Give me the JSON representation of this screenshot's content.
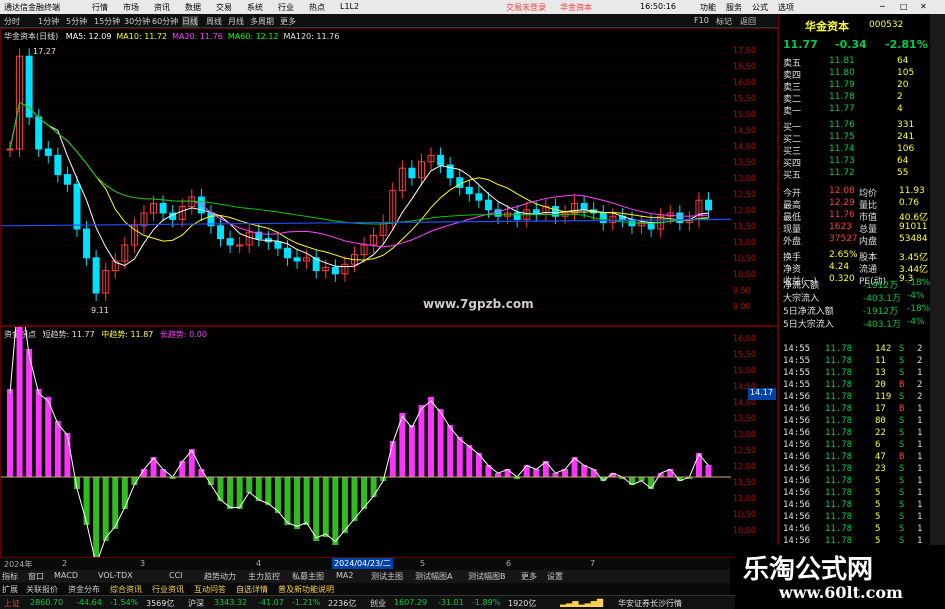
{
  "titlebar": {
    "app": "通达信金融终端",
    "menu": [
      "行情",
      "市场",
      "资讯",
      "数据",
      "交易",
      "系统",
      "行业",
      "热点",
      "L1L2"
    ],
    "login": "交易未登录",
    "stock": "华金资本",
    "time": "16:50:16",
    "buttons": [
      "功能",
      "服务",
      "公式",
      "选项"
    ]
  },
  "toolbar": {
    "periods": [
      "分时",
      "1分钟",
      "5分钟",
      "15分钟",
      "30分钟",
      "60分钟",
      "日线",
      "周线",
      "月线",
      "多周期",
      "更多"
    ],
    "right": [
      "F10",
      "标记",
      "返回"
    ]
  },
  "main": {
    "title": "华金资本(日线)",
    "ma": [
      {
        "label": "MA5: 12.09",
        "color": "#ffffff"
      },
      {
        "label": "MA10: 11.72",
        "color": "#ffff00"
      },
      {
        "label": "MA20: 11.76",
        "color": "#ff40ff"
      },
      {
        "label": "MA60: 12.12",
        "color": "#00ff00"
      },
      {
        "label": "MA120: 11.76",
        "color": "#e0e0e0"
      }
    ],
    "high_mark": "17.27",
    "low_mark": "9.11",
    "site": "www.7gpzb.com",
    "yticks": [
      "17.00",
      "16.50",
      "16.00",
      "15.50",
      "15.00",
      "14.50",
      "14.00",
      "13.50",
      "13.00",
      "12.50",
      "12.00",
      "11.50",
      "11.00",
      "10.50",
      "10.00",
      "9.50",
      "9.00"
    ]
  },
  "sub": {
    "title": "资金拐点",
    "label1": "短趋势: 11.77",
    "label2": "中趋势: 11.87",
    "label3": "长趋势: 0.00",
    "yticks": [
      "16.00",
      "15.50",
      "15.00",
      "14.50",
      "14.00",
      "13.50",
      "13.00",
      "12.50",
      "12.00",
      "11.50",
      "11.00",
      "10.50",
      "10.00"
    ],
    "cursor": "14.17",
    "date_left": "2024年",
    "date_mid": "2024/04/23/二",
    "months": [
      "2",
      "3",
      "4",
      "5",
      "6",
      "7"
    ]
  },
  "tabs": [
    "指标",
    "窗口",
    "MACD",
    "VOL-TDX",
    "CCI",
    "趋势动力",
    "主力监控",
    "私募主图",
    "MA2",
    "测试主图",
    "测试幅图A",
    "测试幅图B",
    "更多",
    "设置"
  ],
  "tabs2": [
    "扩展",
    "关联报价",
    "资金分布",
    "综合资讯",
    "行业资讯",
    "互动问答",
    "自选详情",
    "普及新功能说明"
  ],
  "status": {
    "sh_label": "上证",
    "sh_val": "2860.70",
    "sh_chg": "-44.64",
    "sh_pct": "-1.54%",
    "sh_amt": "3569亿",
    "sz_label": "沪深",
    "sz_val": "3343.32",
    "sz_chg": "-41.07",
    "sz_pct": "-1.21%",
    "sz_amt": "2236亿",
    "cy_label": "创业",
    "cy_val": "1607.29",
    "cy_chg": "-31.01",
    "cy_pct": "-1.89%",
    "cy_amt": "1920亿",
    "broker": "华安证券长沙行情"
  },
  "quote": {
    "name": "华金资本",
    "code": "000532",
    "price": "11.77",
    "chg": "-0.34",
    "pct": "-2.81%",
    "asks": [
      {
        "l": "卖五",
        "p": "11.81",
        "v": "64"
      },
      {
        "l": "卖四",
        "p": "11.80",
        "v": "105"
      },
      {
        "l": "卖三",
        "p": "11.79",
        "v": "20"
      },
      {
        "l": "卖二",
        "p": "11.78",
        "v": "2"
      },
      {
        "l": "卖一",
        "p": "11.77",
        "v": "4"
      }
    ],
    "bids": [
      {
        "l": "买一",
        "p": "11.76",
        "v": "331"
      },
      {
        "l": "买二",
        "p": "11.75",
        "v": "241"
      },
      {
        "l": "买三",
        "p": "11.74",
        "v": "106"
      },
      {
        "l": "买四",
        "p": "11.73",
        "v": "64"
      },
      {
        "l": "买五",
        "p": "11.72",
        "v": "55"
      }
    ],
    "stats": [
      [
        "今开",
        "12.08",
        "均价",
        "11.93"
      ],
      [
        "最高",
        "12.29",
        "量比",
        "0.76"
      ],
      [
        "最低",
        "11.76",
        "市值",
        "40.6亿"
      ],
      [
        "现量",
        "1623",
        "总量",
        "91011"
      ],
      [
        "外盘",
        "37527",
        "内盘",
        "53484"
      ]
    ],
    "stats2": [
      [
        "换手",
        "2.65%",
        "股本",
        "3.45亿"
      ],
      [
        "净资",
        "4.24",
        "流通",
        "3.44亿"
      ],
      [
        "收益(一)",
        "0.320",
        "PE(动)",
        "9.3"
      ]
    ],
    "flows": [
      {
        "l": "净流入额",
        "v": "-1912万",
        "p": "-18%"
      },
      {
        "l": "大宗流入",
        "v": "-403.1万",
        "p": "-4%"
      },
      {
        "l": "5日净流入额",
        "v": "-1912万",
        "p": "-18%"
      },
      {
        "l": "5日大宗流入",
        "v": "-403.1万",
        "p": "-4%"
      }
    ],
    "ticks": [
      [
        "14:55",
        "11.78",
        "142",
        "S",
        "2"
      ],
      [
        "14:55",
        "11.78",
        "11",
        "S",
        "2"
      ],
      [
        "14:55",
        "11.78",
        "13",
        "S",
        "1"
      ],
      [
        "14:55",
        "11.78",
        "20",
        "B",
        "2"
      ],
      [
        "14:56",
        "11.78",
        "119",
        "S",
        "2"
      ],
      [
        "14:56",
        "11.78",
        "17",
        "B",
        "1"
      ],
      [
        "14:56",
        "11.78",
        "80",
        "S",
        "1"
      ],
      [
        "14:56",
        "11.78",
        "22",
        "S",
        "1"
      ],
      [
        "14:56",
        "11.78",
        "6",
        "S",
        "1"
      ],
      [
        "14:56",
        "11.78",
        "47",
        "B",
        "1"
      ],
      [
        "14:56",
        "11.78",
        "23",
        "S",
        "1"
      ],
      [
        "14:56",
        "11.78",
        "5",
        "S",
        "1"
      ],
      [
        "14:56",
        "11.78",
        "5",
        "S",
        "1"
      ],
      [
        "14:56",
        "11.78",
        "5",
        "S",
        "1"
      ],
      [
        "14:56",
        "11.78",
        "5",
        "S",
        "1"
      ],
      [
        "14:56",
        "11.78",
        "5",
        "S",
        "1"
      ],
      [
        "14:56",
        "11.78",
        "5",
        "S",
        "1"
      ]
    ]
  },
  "watermark": {
    "cn": "乐淘公式网",
    "url": "www.60lt.com"
  },
  "colors": {
    "up": "#ff3a3a",
    "down": "#00cc44",
    "accent": "#ffff33"
  }
}
